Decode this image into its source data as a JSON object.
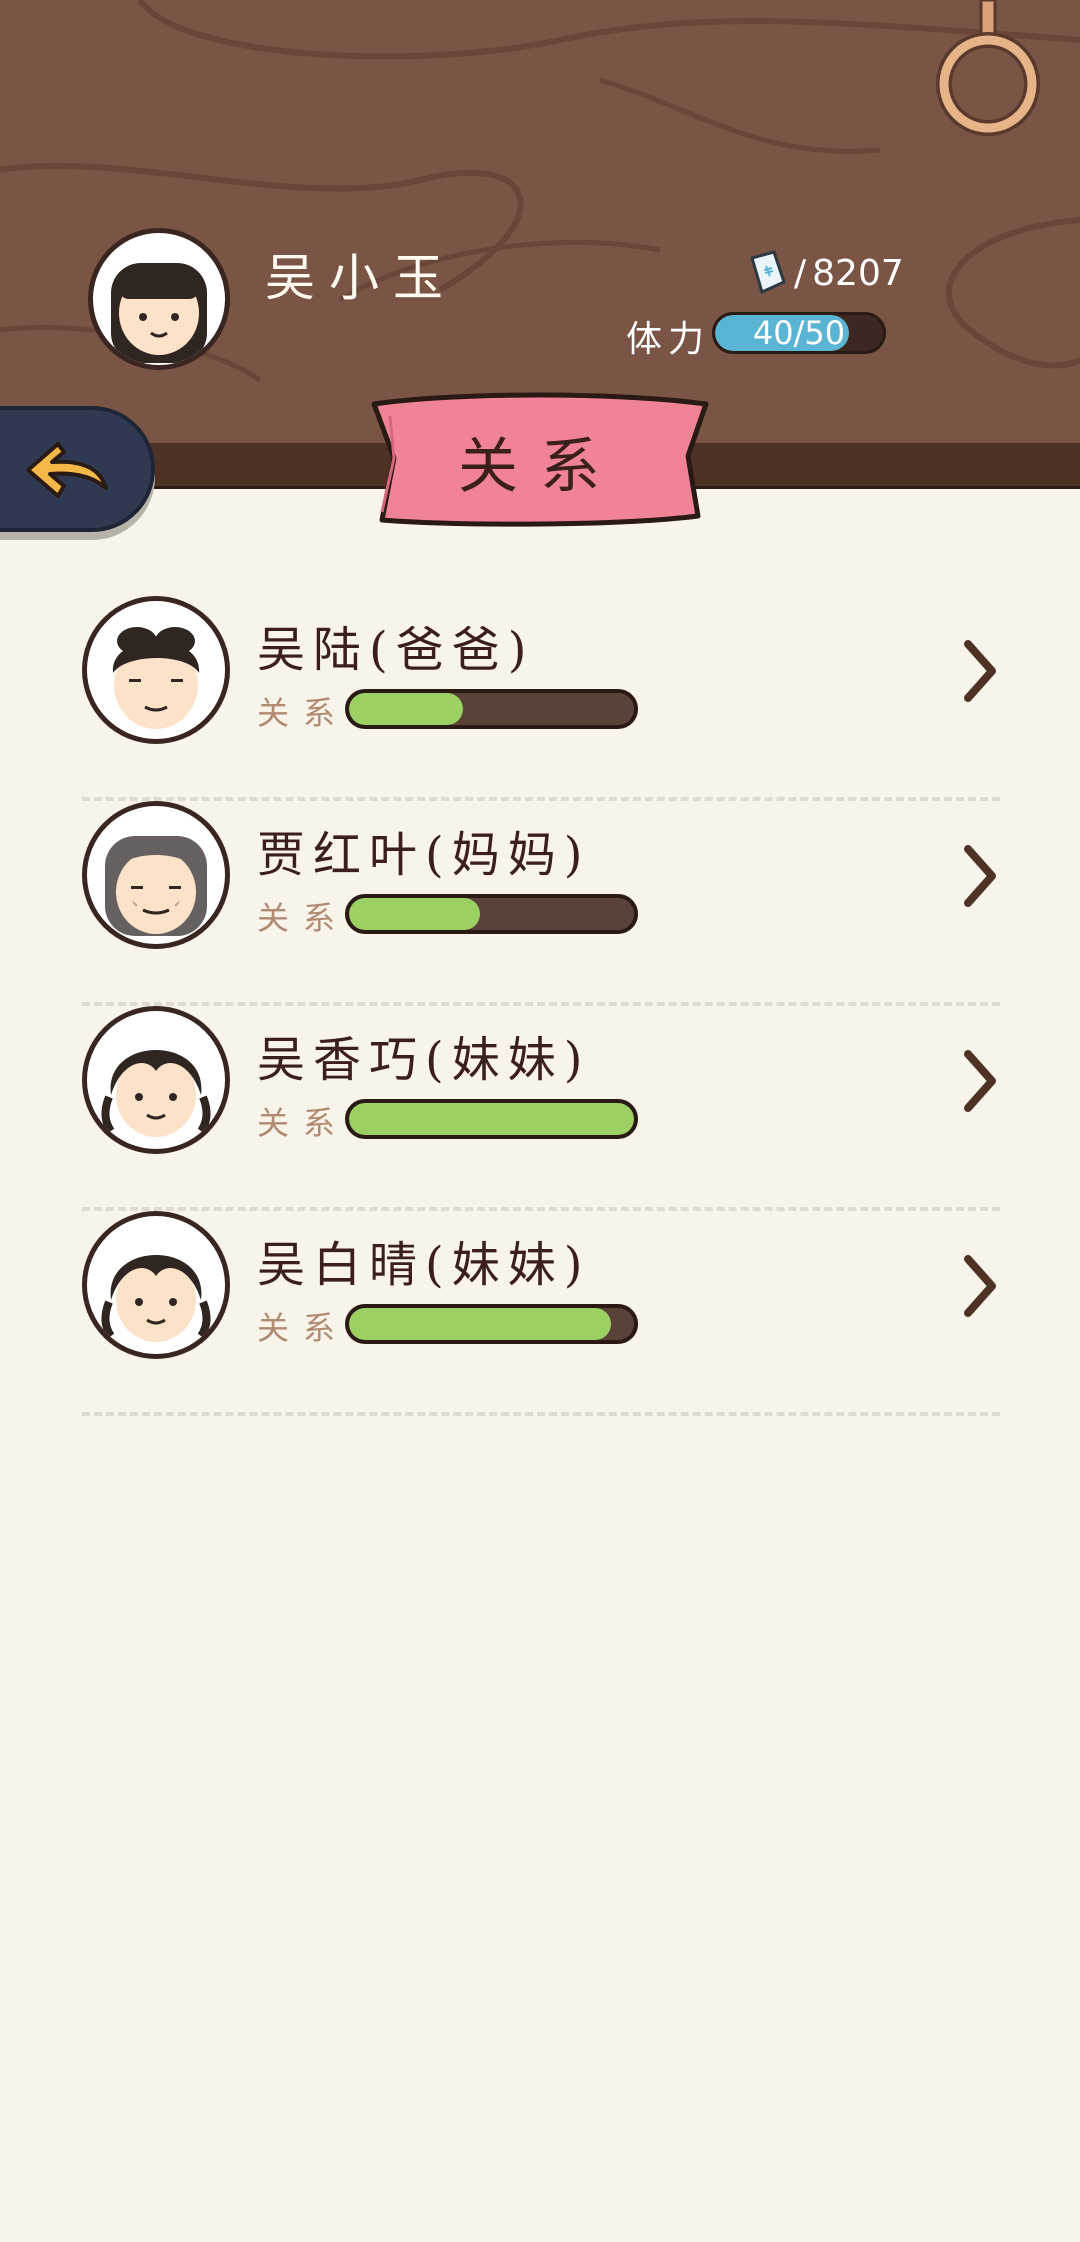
{
  "player": {
    "name": "吴小玉",
    "money": "8207",
    "money_prefix": "/",
    "stamina_label": "体力",
    "stamina_text": "40/50",
    "stamina_value": 40,
    "stamina_max": 50
  },
  "page": {
    "title": "关系"
  },
  "relations": [
    {
      "name": "吴陆(爸爸)",
      "label": "关系",
      "level": 0.4,
      "avatar": "father"
    },
    {
      "name": "贾红叶(妈妈)",
      "label": "关系",
      "level": 0.46,
      "avatar": "mother"
    },
    {
      "name": "吴香巧(妹妹)",
      "label": "关系",
      "level": 1.0,
      "avatar": "sister"
    },
    {
      "name": "吴白晴(妹妹)",
      "label": "关系",
      "level": 0.92,
      "avatar": "sister"
    }
  ],
  "colors": {
    "wood": "#7a5444",
    "banner": "#f18397",
    "fill_green": "#9bd163",
    "fill_blue": "#5ab5d4",
    "back_button": "#2f3a52",
    "arrow": "#f4b848"
  }
}
